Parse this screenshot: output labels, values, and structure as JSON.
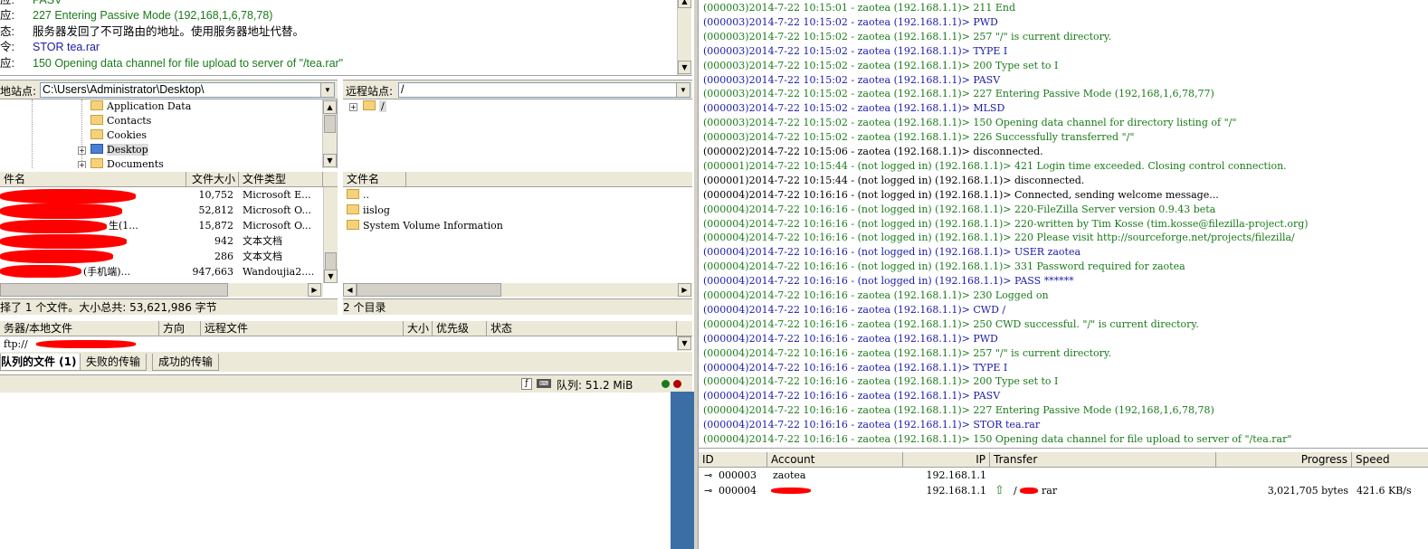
{
  "message_log": [
    {
      "label": "应:",
      "text": "PASV",
      "color": "#1a7a1a"
    },
    {
      "label": "应:",
      "text": "227 Entering Passive Mode (192,168,1,6,78,78)",
      "color": "#1a7a1a"
    },
    {
      "label": "态:",
      "text": "服务器发回了不可路由的地址。使用服务器地址代替。",
      "color": "#000000"
    },
    {
      "label": "令:",
      "text": "STOR tea.rar",
      "color": "#1a1aa8"
    },
    {
      "label": "应:",
      "text": "150 Opening data channel for file upload to server of \"/tea.rar\"",
      "color": "#1a7a1a"
    }
  ],
  "local_site": {
    "label": "地站点:",
    "path": "C:\\Users\\Administrator\\Desktop\\"
  },
  "remote_site": {
    "label": "远程站点:",
    "path": "/"
  },
  "local_tree": [
    "Application Data",
    "Contacts",
    "Cookies",
    "Desktop",
    "Documents"
  ],
  "remote_tree": [
    "/"
  ],
  "local_columns": [
    "件名",
    "文件大小",
    "文件类型"
  ],
  "local_files": [
    {
      "name": "",
      "size": "10,752",
      "type": "Microsoft E..."
    },
    {
      "name": "",
      "size": "52,812",
      "type": "Microsoft O..."
    },
    {
      "name": "生(1...",
      "size": "15,872",
      "type": "Microsoft O..."
    },
    {
      "name": "",
      "size": "942",
      "type": "文本文档"
    },
    {
      "name": "",
      "size": "286",
      "type": "文本文档"
    },
    {
      "name": "(手机端)...",
      "size": "947,663",
      "type": "Wandoujia2...."
    }
  ],
  "remote_columns": [
    "文件名"
  ],
  "remote_files": [
    "..",
    "iislog",
    "System Volume Information"
  ],
  "local_status": "择了 1 个文件。大小总共: 53,621,986 字节",
  "remote_status": "2 个目录",
  "queue_columns": [
    "务器/本地文件",
    "方向",
    "远程文件",
    "大小",
    "优先级",
    "状态"
  ],
  "queue_row": "ftp://",
  "tabs": [
    "队列的文件 (1)",
    "失败的传输",
    "成功的传输"
  ],
  "statusbar": {
    "queue": "队列: 51.2 MiB"
  },
  "server_log": [
    {
      "text": "(000003)2014-7-22 10:15:01 - zaotea (192.168.1.1)> 211 End",
      "c": "green"
    },
    {
      "text": "(000003)2014-7-22 10:15:02 - zaotea (192.168.1.1)> PWD",
      "c": "blue"
    },
    {
      "text": "(000003)2014-7-22 10:15:02 - zaotea (192.168.1.1)> 257 \"/\" is current directory.",
      "c": "green"
    },
    {
      "text": "(000003)2014-7-22 10:15:02 - zaotea (192.168.1.1)> TYPE I",
      "c": "blue"
    },
    {
      "text": "(000003)2014-7-22 10:15:02 - zaotea (192.168.1.1)> 200 Type set to I",
      "c": "green"
    },
    {
      "text": "(000003)2014-7-22 10:15:02 - zaotea (192.168.1.1)> PASV",
      "c": "blue"
    },
    {
      "text": "(000003)2014-7-22 10:15:02 - zaotea (192.168.1.1)> 227 Entering Passive Mode (192,168,1,6,78,77)",
      "c": "green"
    },
    {
      "text": "(000003)2014-7-22 10:15:02 - zaotea (192.168.1.1)> MLSD",
      "c": "blue"
    },
    {
      "text": "(000003)2014-7-22 10:15:02 - zaotea (192.168.1.1)> 150 Opening data channel for directory listing of \"/\"",
      "c": "green"
    },
    {
      "text": "(000003)2014-7-22 10:15:02 - zaotea (192.168.1.1)> 226 Successfully transferred \"/\"",
      "c": "green"
    },
    {
      "text": "(000002)2014-7-22 10:15:06 - zaotea (192.168.1.1)> disconnected.",
      "c": "black"
    },
    {
      "text": "(000001)2014-7-22 10:15:44 - (not logged in) (192.168.1.1)> 421 Login time exceeded. Closing control connection.",
      "c": "green"
    },
    {
      "text": "(000001)2014-7-22 10:15:44 - (not logged in) (192.168.1.1)> disconnected.",
      "c": "black"
    },
    {
      "text": "(000004)2014-7-22 10:16:16 - (not logged in) (192.168.1.1)> Connected, sending welcome message...",
      "c": "black"
    },
    {
      "text": "(000004)2014-7-22 10:16:16 - (not logged in) (192.168.1.1)> 220-FileZilla Server version 0.9.43 beta",
      "c": "green"
    },
    {
      "text": "(000004)2014-7-22 10:16:16 - (not logged in) (192.168.1.1)> 220-written by Tim Kosse (tim.kosse@filezilla-project.org)",
      "c": "green"
    },
    {
      "text": "(000004)2014-7-22 10:16:16 - (not logged in) (192.168.1.1)> 220 Please visit http://sourceforge.net/projects/filezilla/",
      "c": "green"
    },
    {
      "text": "(000004)2014-7-22 10:16:16 - (not logged in) (192.168.1.1)> USER zaotea",
      "c": "blue"
    },
    {
      "text": "(000004)2014-7-22 10:16:16 - (not logged in) (192.168.1.1)> 331 Password required for zaotea",
      "c": "green"
    },
    {
      "text": "(000004)2014-7-22 10:16:16 - (not logged in) (192.168.1.1)> PASS ******",
      "c": "blue"
    },
    {
      "text": "(000004)2014-7-22 10:16:16 - zaotea (192.168.1.1)> 230 Logged on",
      "c": "green"
    },
    {
      "text": "(000004)2014-7-22 10:16:16 - zaotea (192.168.1.1)> CWD /",
      "c": "blue"
    },
    {
      "text": "(000004)2014-7-22 10:16:16 - zaotea (192.168.1.1)> 250 CWD successful. \"/\" is current directory.",
      "c": "green"
    },
    {
      "text": "(000004)2014-7-22 10:16:16 - zaotea (192.168.1.1)> PWD",
      "c": "blue"
    },
    {
      "text": "(000004)2014-7-22 10:16:16 - zaotea (192.168.1.1)> 257 \"/\" is current directory.",
      "c": "green"
    },
    {
      "text": "(000004)2014-7-22 10:16:16 - zaotea (192.168.1.1)> TYPE I",
      "c": "blue"
    },
    {
      "text": "(000004)2014-7-22 10:16:16 - zaotea (192.168.1.1)> 200 Type set to I",
      "c": "green"
    },
    {
      "text": "(000004)2014-7-22 10:16:16 - zaotea (192.168.1.1)> PASV",
      "c": "blue"
    },
    {
      "text": "(000004)2014-7-22 10:16:16 - zaotea (192.168.1.1)> 227 Entering Passive Mode (192,168,1,6,78,78)",
      "c": "green"
    },
    {
      "text": "(000004)2014-7-22 10:16:16 - zaotea (192.168.1.1)> STOR tea.rar",
      "c": "blue"
    },
    {
      "text": "(000004)2014-7-22 10:16:16 - zaotea (192.168.1.1)> 150 Opening data channel for file upload to server of \"/tea.rar\"",
      "c": "green"
    }
  ],
  "conn_columns": [
    "ID",
    "Account",
    "IP",
    "Transfer",
    "Progress",
    "Speed"
  ],
  "connections": [
    {
      "id": "000003",
      "account": "zaotea",
      "ip": "192.168.1.1",
      "transfer": "",
      "progress": "",
      "speed": ""
    },
    {
      "id": "000004",
      "account": "",
      "ip": "192.168.1.1",
      "transfer": "/",
      "transfer_tail": "rar",
      "progress": "3,021,705 bytes",
      "speed": "421.6 KB/s"
    }
  ],
  "colors": {
    "blue": "#1a1aa8",
    "green": "#1a7a1a",
    "redact": "#ff0000",
    "accent": "#3a6ea5"
  }
}
